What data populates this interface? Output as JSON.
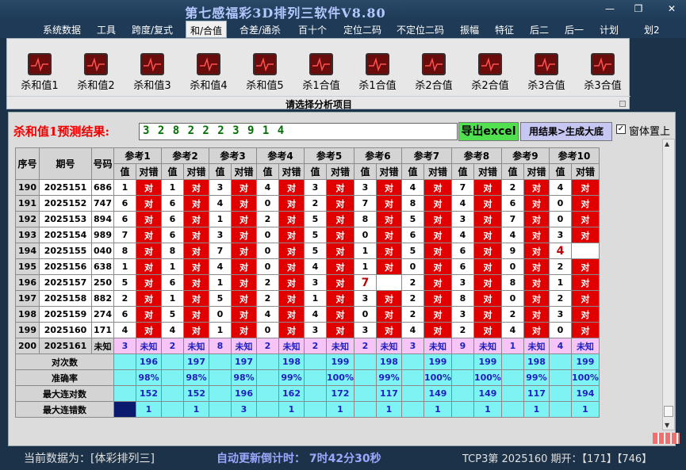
{
  "window": {
    "title": "第七感福彩3D排列三软件V8.80",
    "minimize": "—",
    "restore": "❐",
    "close": "✕"
  },
  "menu": [
    "系统数据",
    "工具",
    "跨度/复式",
    "和/合值",
    "合差/通杀",
    "百十个",
    "定位二码",
    "不定位二码",
    "振幅",
    "特征",
    "后二",
    "后一",
    "计划",
    "划2"
  ],
  "menu_active": 3,
  "ribbon": {
    "buttons": [
      "杀和值1",
      "杀和值2",
      "杀和值3",
      "杀和值4",
      "杀和值5",
      "杀1合值",
      "杀1合值",
      "杀2合值",
      "杀2合值",
      "杀3合值",
      "杀3合值"
    ],
    "caption": "请选择分析项目"
  },
  "prediction": {
    "label": "杀和值1预测结果:",
    "value": "3 2 8 2 2 2 3 9 1 4",
    "export_btn": "导出excel",
    "gen_btn": "用结果>生成大底",
    "pin_label": "窗体置上",
    "pin_checked": "✓"
  },
  "table": {
    "headers": {
      "seq": "序号",
      "period": "期号",
      "number": "号码",
      "val": "值",
      "ok": "对错"
    },
    "refs": [
      "参考1",
      "参考2",
      "参考3",
      "参考4",
      "参考5",
      "参考6",
      "参考7",
      "参考8",
      "参考9",
      "参考10"
    ],
    "rows": [
      {
        "seq": "190",
        "period": "2025151",
        "num": "686",
        "vals": [
          "1",
          "1",
          "3",
          "4",
          "3",
          "3",
          "4",
          "7",
          "2",
          "4"
        ],
        "res": [
          "对",
          "对",
          "对",
          "对",
          "对",
          "对",
          "对",
          "对",
          "对",
          "对"
        ]
      },
      {
        "seq": "191",
        "period": "2025152",
        "num": "747",
        "vals": [
          "6",
          "6",
          "4",
          "0",
          "2",
          "7",
          "8",
          "4",
          "6",
          "0"
        ],
        "res": [
          "对",
          "对",
          "对",
          "对",
          "对",
          "对",
          "对",
          "对",
          "对",
          "对"
        ]
      },
      {
        "seq": "192",
        "period": "2025153",
        "num": "894",
        "vals": [
          "6",
          "6",
          "1",
          "2",
          "5",
          "8",
          "5",
          "3",
          "7",
          "0"
        ],
        "res": [
          "对",
          "对",
          "对",
          "对",
          "对",
          "对",
          "对",
          "对",
          "对",
          "对"
        ]
      },
      {
        "seq": "193",
        "period": "2025154",
        "num": "989",
        "vals": [
          "7",
          "6",
          "3",
          "0",
          "5",
          "0",
          "6",
          "4",
          "4",
          "3"
        ],
        "res": [
          "对",
          "对",
          "对",
          "对",
          "对",
          "对",
          "对",
          "对",
          "对",
          "对"
        ]
      },
      {
        "seq": "194",
        "period": "2025155",
        "num": "040",
        "vals": [
          "8",
          "8",
          "7",
          "0",
          "5",
          "1",
          "5",
          "6",
          "9",
          "4"
        ],
        "res": [
          "对",
          "对",
          "对",
          "对",
          "对",
          "对",
          "对",
          "对",
          "对",
          ""
        ]
      },
      {
        "seq": "195",
        "period": "2025156",
        "num": "638",
        "vals": [
          "1",
          "1",
          "4",
          "0",
          "4",
          "1",
          "0",
          "6",
          "0",
          "2"
        ],
        "res": [
          "对",
          "对",
          "对",
          "对",
          "对",
          "对",
          "对",
          "对",
          "对",
          "对"
        ]
      },
      {
        "seq": "196",
        "period": "2025157",
        "num": "250",
        "vals": [
          "5",
          "6",
          "1",
          "2",
          "3",
          "7",
          "2",
          "3",
          "8",
          "1"
        ],
        "res": [
          "对",
          "对",
          "对",
          "对",
          "对",
          "",
          "对",
          "对",
          "对",
          "对"
        ]
      },
      {
        "seq": "197",
        "period": "2025158",
        "num": "882",
        "vals": [
          "2",
          "1",
          "5",
          "2",
          "1",
          "3",
          "2",
          "8",
          "0",
          "2"
        ],
        "res": [
          "对",
          "对",
          "对",
          "对",
          "对",
          "对",
          "对",
          "对",
          "对",
          "对"
        ]
      },
      {
        "seq": "198",
        "period": "2025159",
        "num": "274",
        "vals": [
          "6",
          "5",
          "0",
          "4",
          "4",
          "0",
          "2",
          "3",
          "2",
          "3"
        ],
        "res": [
          "对",
          "对",
          "对",
          "对",
          "对",
          "对",
          "对",
          "对",
          "对",
          "对"
        ]
      },
      {
        "seq": "199",
        "period": "2025160",
        "num": "171",
        "vals": [
          "4",
          "4",
          "1",
          "0",
          "3",
          "3",
          "4",
          "2",
          "4",
          "0"
        ],
        "res": [
          "对",
          "对",
          "对",
          "对",
          "对",
          "对",
          "对",
          "对",
          "对",
          "对"
        ]
      }
    ],
    "miss_cells": [
      [
        4,
        9
      ],
      [
        6,
        5
      ]
    ],
    "pred_row": {
      "seq": "200",
      "period": "2025161",
      "num": "未知",
      "vals": [
        "3",
        "2",
        "8",
        "2",
        "2",
        "2",
        "3",
        "9",
        "1",
        "4"
      ],
      "res": "未知"
    },
    "stats": [
      {
        "label": "对次数",
        "values": [
          "196",
          "197",
          "197",
          "198",
          "199",
          "198",
          "199",
          "199",
          "198",
          "199"
        ]
      },
      {
        "label": "准确率",
        "values": [
          "98%",
          "98%",
          "98%",
          "99%",
          "100%",
          "99%",
          "100%",
          "100%",
          "99%",
          "100%"
        ]
      },
      {
        "label": "最大连对数",
        "values": [
          "152",
          "152",
          "196",
          "162",
          "172",
          "117",
          "149",
          "149",
          "117",
          "194"
        ]
      },
      {
        "label": "最大连错数",
        "values": [
          "1",
          "1",
          "3",
          "1",
          "1",
          "1",
          "1",
          "1",
          "1",
          "1"
        ]
      }
    ]
  },
  "status": {
    "left": "当前数据为：[体彩排列三]",
    "mid": "自动更新倒计时：  7时42分30秒",
    "right": "TCP3第 2025160 期开：【171】【746】"
  },
  "colors": {
    "hit_red": "#e00000",
    "pred_pink": "#f6c4f6",
    "stat_cyan": "#7ef3f3",
    "export_green": "#50e050"
  }
}
